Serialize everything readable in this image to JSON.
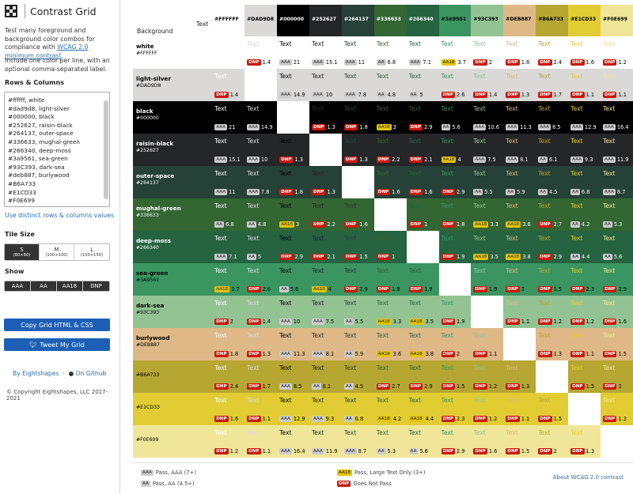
{
  "app": {
    "title": "Contrast Grid"
  },
  "sidebar": {
    "intro_pre": "Test many foreground and background color combos for compliance with ",
    "intro_link": "WCAG 2.0 minimum contrast",
    "intro_post": ".",
    "intro2": "Include one color per line, with an optional comma-separated label.",
    "rows_label": "Rows & Columns",
    "colors_text": "#ffffff, white\n#dad9d8, light-silver\n#000000, black\n#252627, raisin-black\n#264137, outer-space\n#336633, mughal-green\n#266340, deep-moss\n#3a9561, sea-green\n#93C393, dark-sea\n#deb887, burlywood\n#B6A733\n#E1CD33\n#F0E699",
    "distinct_link": "Use distinct rows & columns values",
    "tile_label": "Tile Size",
    "tile_sizes": [
      {
        "label": "S",
        "sub": "(80×80)",
        "active": true
      },
      {
        "label": "M",
        "sub": "(100×100)",
        "active": false
      },
      {
        "label": "L",
        "sub": "(150×150)",
        "active": false
      }
    ],
    "show_label": "Show",
    "show_options": [
      "AAA",
      "AA",
      "AA18",
      "DNP"
    ],
    "copy_button": "Copy Grid HTML & CSS",
    "tweet_button": "Tweet My Grid",
    "by_link": "By Eightshapes",
    "github_link": "On Github",
    "copyright": "© Copyright Eightshapes, LLC 2017-2021"
  },
  "grid": {
    "corner_text": "Text",
    "corner_bg": "Background",
    "sample": "Text",
    "columns": [
      "#FFFFFF",
      "#DAD9D8",
      "#000000",
      "#252627",
      "#264137",
      "#336633",
      "#266340",
      "#3A9561",
      "#93C393",
      "#DEB887",
      "#B6A733",
      "#E1CD33",
      "#F0E699"
    ],
    "rows": [
      {
        "name": "white",
        "hex": "#FFFFFF"
      },
      {
        "name": "light-silver",
        "hex": "#DAD9D8"
      },
      {
        "name": "black",
        "hex": "#000000"
      },
      {
        "name": "raisin-black",
        "hex": "#252627"
      },
      {
        "name": "outer-space",
        "hex": "#264137"
      },
      {
        "name": "mughal-green",
        "hex": "#336633"
      },
      {
        "name": "deep-moss",
        "hex": "#266340"
      },
      {
        "name": "sea-green",
        "hex": "#3A9561"
      },
      {
        "name": "dark-sea",
        "hex": "#93C393"
      },
      {
        "name": "burlywood",
        "hex": "#DEB887"
      },
      {
        "name": "",
        "hex": "#B6A733"
      },
      {
        "name": "",
        "hex": "#E1CD33"
      },
      {
        "name": "",
        "hex": "#F0E699"
      }
    ],
    "cells": [
      [
        null,
        [
          "DNP",
          "1.4"
        ],
        [
          "AAA",
          "21"
        ],
        [
          "AAA",
          "15.1"
        ],
        [
          "AAA",
          "11"
        ],
        [
          "AA",
          "6.8"
        ],
        [
          "AAA",
          "7.1"
        ],
        [
          "AA18",
          "3.7"
        ],
        [
          "DNP",
          "2"
        ],
        [
          "DNP",
          "1.8"
        ],
        [
          "DNP",
          "2.4"
        ],
        [
          "DNP",
          "1.6"
        ],
        [
          "DNP",
          "1.2"
        ]
      ],
      [
        [
          "DNP",
          "1.4"
        ],
        null,
        [
          "AAA",
          "14.9"
        ],
        [
          "AAA",
          "10"
        ],
        [
          "AAA",
          "7.8"
        ],
        [
          "AA",
          "4.8"
        ],
        [
          "AA",
          "5"
        ],
        [
          "DNP",
          "2.6"
        ],
        [
          "DNP",
          "1.4"
        ],
        [
          "DNP",
          "1.3"
        ],
        [
          "DNP",
          "1.7"
        ],
        [
          "DNP",
          "1.1"
        ],
        [
          "DNP",
          "1.1"
        ]
      ],
      [
        [
          "AAA",
          "21"
        ],
        [
          "AAA",
          "14.9"
        ],
        null,
        [
          "DNP",
          "1.3"
        ],
        [
          "DNP",
          "1.8"
        ],
        [
          "AA18",
          "3"
        ],
        [
          "DNP",
          "2.9"
        ],
        [
          "AA",
          "5.6"
        ],
        [
          "AAA",
          "10.6"
        ],
        [
          "AAA",
          "11.3"
        ],
        [
          "AAA",
          "8.5"
        ],
        [
          "AAA",
          "12.9"
        ],
        [
          "AAA",
          "16.4"
        ]
      ],
      [
        [
          "AAA",
          "15.1"
        ],
        [
          "AAA",
          "10"
        ],
        [
          "DNP",
          "1.3"
        ],
        null,
        [
          "DNP",
          "1.3"
        ],
        [
          "DNP",
          "2.2"
        ],
        [
          "DNP",
          "2.1"
        ],
        [
          "AA18",
          "4"
        ],
        [
          "AAA",
          "7.5"
        ],
        [
          "AAA",
          "8.1"
        ],
        [
          "AA",
          "6.1"
        ],
        [
          "AAA",
          "9.3"
        ],
        [
          "AAA",
          "11.9"
        ]
      ],
      [
        [
          "AAA",
          "11"
        ],
        [
          "AAA",
          "7.8"
        ],
        [
          "DNP",
          "1.8"
        ],
        [
          "DNP",
          "1.3"
        ],
        null,
        [
          "DNP",
          "1.6"
        ],
        [
          "DNP",
          "1.6"
        ],
        [
          "DNP",
          "2.9"
        ],
        [
          "AA",
          "5.5"
        ],
        [
          "AA",
          "5.9"
        ],
        [
          "AA",
          "4.5"
        ],
        [
          "AA",
          "6.8"
        ],
        [
          "AAA",
          "8.7"
        ]
      ],
      [
        [
          "AA",
          "6.8"
        ],
        [
          "AA",
          "4.8"
        ],
        [
          "AA18",
          "3"
        ],
        [
          "DNP",
          "2.2"
        ],
        [
          "DNP",
          "1.6"
        ],
        null,
        [
          "DNP",
          "1"
        ],
        [
          "DNP",
          "1.8"
        ],
        [
          "AA18",
          "3.3"
        ],
        [
          "AA18",
          "3.6"
        ],
        [
          "DNP",
          "2.7"
        ],
        [
          "AA",
          "4.2"
        ],
        [
          "AA",
          "5.3"
        ]
      ],
      [
        [
          "AAA",
          "7.1"
        ],
        [
          "AA",
          "5"
        ],
        [
          "DNP",
          "2.9"
        ],
        [
          "DNP",
          "2.1"
        ],
        [
          "DNP",
          "1.5"
        ],
        [
          "DNP",
          "1"
        ],
        null,
        [
          "DNP",
          "1.9"
        ],
        [
          "AA18",
          "3.5"
        ],
        [
          "AA18",
          "3.8"
        ],
        [
          "DNP",
          "2.9"
        ],
        [
          "AA",
          "4.4"
        ],
        [
          "AA",
          "5.6"
        ]
      ],
      [
        [
          "AA18",
          "3.7"
        ],
        [
          "DNP",
          "2.6"
        ],
        [
          "AA",
          "5.6"
        ],
        [
          "AA18",
          "4"
        ],
        [
          "DNP",
          "2.9"
        ],
        [
          "DNP",
          "1.8"
        ],
        [
          "DNP",
          "1.9"
        ],
        null,
        [
          "DNP",
          "1.9"
        ],
        [
          "DNP",
          "2"
        ],
        [
          "DNP",
          "1.5"
        ],
        [
          "DNP",
          "2.3"
        ],
        [
          "DNP",
          "2.9"
        ]
      ],
      [
        [
          "DNP",
          "2"
        ],
        [
          "DNP",
          "1.4"
        ],
        [
          "AAA",
          "10"
        ],
        [
          "AAA",
          "7.5"
        ],
        [
          "AA",
          "5.5"
        ],
        [
          "AA18",
          "3.3"
        ],
        [
          "AA18",
          "3.5"
        ],
        [
          "DNP",
          "1.9"
        ],
        null,
        [
          "DNP",
          "1.1"
        ],
        [
          "DNP",
          "1.2"
        ],
        [
          "DNP",
          "1.2"
        ],
        [
          "DNP",
          "1.6"
        ]
      ],
      [
        [
          "DNP",
          "1.8"
        ],
        [
          "DNP",
          "1.3"
        ],
        [
          "AAA",
          "11.3"
        ],
        [
          "AAA",
          "8.1"
        ],
        [
          "AA",
          "5.9"
        ],
        [
          "AA18",
          "3.6"
        ],
        [
          "AA18",
          "3.8"
        ],
        [
          "DNP",
          "2"
        ],
        [
          "DNP",
          "1.1"
        ],
        null,
        [
          "DNP",
          "1.3"
        ],
        [
          "DNP",
          "1.1"
        ],
        [
          "DNP",
          "1.5"
        ]
      ],
      [
        [
          "DNP",
          "2.4"
        ],
        [
          "DNP",
          "1.7"
        ],
        [
          "AAA",
          "8.5"
        ],
        [
          "AA",
          "6.1"
        ],
        [
          "AA",
          "4.5"
        ],
        [
          "DNP",
          "2.7"
        ],
        [
          "DNP",
          "2.9"
        ],
        [
          "DNP",
          "1.5"
        ],
        [
          "DNP",
          "1.2"
        ],
        [
          "DNP",
          "1.3"
        ],
        null,
        [
          "DNP",
          "1.5"
        ],
        [
          "DNP",
          "2"
        ]
      ],
      [
        [
          "DNP",
          "1.6"
        ],
        [
          "DNP",
          "1.1"
        ],
        [
          "AAA",
          "12.9"
        ],
        [
          "AAA",
          "9.3"
        ],
        [
          "AA",
          "6.8"
        ],
        [
          "AA18",
          "4.2"
        ],
        [
          "AA18",
          "4.4"
        ],
        [
          "DNP",
          "2.3"
        ],
        [
          "DNP",
          "1.2"
        ],
        [
          "DNP",
          "1.1"
        ],
        [
          "DNP",
          "1.5"
        ],
        null,
        [
          "DNP",
          "1.3"
        ]
      ],
      [
        [
          "DNP",
          "1.2"
        ],
        [
          "DNP",
          "1.1"
        ],
        [
          "AAA",
          "16.4"
        ],
        [
          "AAA",
          "11.9"
        ],
        [
          "AAA",
          "8.7"
        ],
        [
          "AA",
          "5.3"
        ],
        [
          "AA",
          "5.6"
        ],
        [
          "DNP",
          "2.9"
        ],
        [
          "DNP",
          "1.6"
        ],
        [
          "DNP",
          "1.5"
        ],
        [
          "DNP",
          "2"
        ],
        [
          "DNP",
          "1.3"
        ],
        null
      ]
    ]
  },
  "legend": {
    "aaa_badge": "AAA",
    "aaa_text": "Pass, AAA (7+)",
    "aa_badge": "AA",
    "aa_text": "Pass, AA (4.5+)",
    "aa18_badge": "AA18",
    "aa18_text": "Pass, Large Text Only (3+)",
    "dnp_badge": "DNP",
    "dnp_text": "Does Not Pass",
    "about_link": "About WCAG 2.0 contrast"
  }
}
